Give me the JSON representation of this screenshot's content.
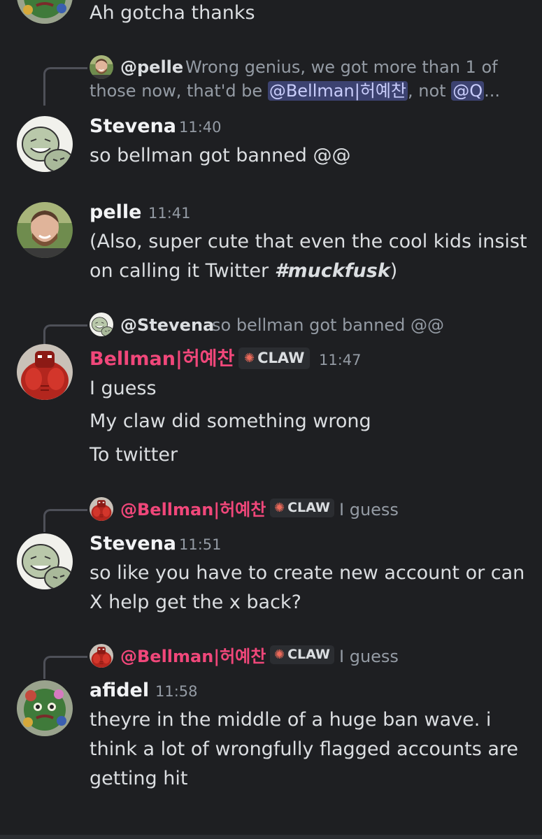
{
  "colors": {
    "background": "#1e1f22",
    "pink_name": "#f0477a",
    "mention_bg": "#3c4270"
  },
  "messages": [
    {
      "text": "Ah gotcha thanks"
    },
    {
      "reply": {
        "author": "@pelle",
        "text_a": "Wrong genius, we got more than 1 of",
        "text_b": "those now, that'd be",
        "mention1": "@Bellman|허예찬",
        "mid": ", not",
        "mention2": "@Q",
        "ellipsis": "..."
      },
      "author": "Stevena",
      "time": "11:40",
      "lines": [
        "so bellman got banned @@"
      ]
    },
    {
      "author": "pelle",
      "time": "11:41",
      "line1": "(Also, super cute that even the cool kids insist",
      "line2_a": "on calling it Twitter ",
      "line2_hashtag": "#muckfusk",
      "line2_b": ")"
    },
    {
      "reply": {
        "author": "@Stevena",
        "text": "so bellman got banned @@"
      },
      "author": "Bellman|허예찬",
      "tag": "CLAW",
      "time": "11:47",
      "lines": [
        "I guess",
        "My claw did something wrong",
        "To twitter"
      ]
    },
    {
      "reply": {
        "author": "@Bellman|허예찬",
        "tag": "CLAW",
        "text": "I guess"
      },
      "author": "Stevena",
      "time": "11:51",
      "lines": [
        "so like you have to create new account or can",
        "X help get the x back?"
      ]
    },
    {
      "reply": {
        "author": "@Bellman|허예찬",
        "tag": "CLAW",
        "text": "I guess"
      },
      "author": "afidel",
      "time": "11:58",
      "lines": [
        "theyre in the middle of a huge ban wave. i",
        "think a lot of wrongfully flagged accounts are",
        "getting hit"
      ]
    }
  ]
}
